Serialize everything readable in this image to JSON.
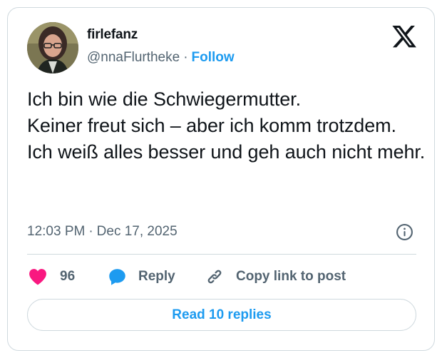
{
  "author": {
    "display_name": "firlefanz",
    "handle": "@nnaFlurtheke",
    "separator": "·",
    "follow_label": "Follow"
  },
  "tweet": {
    "lines": [
      "Ich bin wie die Schwiegermutter.",
      "Keiner freut sich – aber ich komm trotzdem.",
      "Ich weiß alles besser und geh auch nicht mehr."
    ]
  },
  "meta": {
    "time": "12:03 PM",
    "separator": "·",
    "date": "Dec 17, 2025"
  },
  "actions": {
    "like_count": "96",
    "reply_label": "Reply",
    "copy_label": "Copy link to post"
  },
  "footer": {
    "read_replies_label": "Read 10 replies"
  },
  "colors": {
    "accent": "#1d9bf0",
    "like": "#f91880",
    "secondary_text": "#536471",
    "border": "#cfd9de"
  },
  "icons": {
    "brand": "x-logo-icon",
    "info": "info-icon",
    "like": "heart-icon",
    "reply": "speech-bubble-icon",
    "copy": "link-icon"
  }
}
